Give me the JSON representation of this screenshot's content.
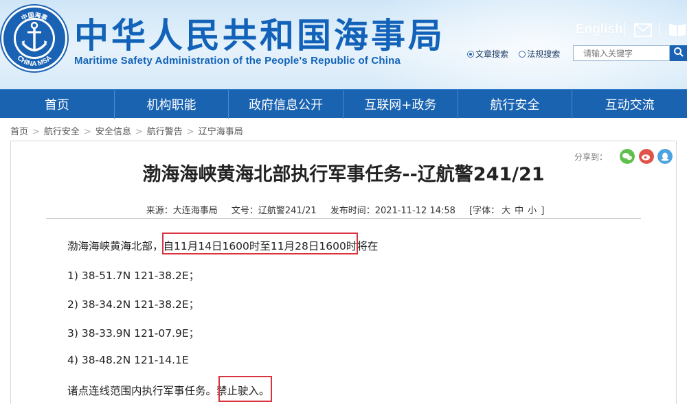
{
  "header": {
    "logo": {
      "top_text": "中国海事",
      "bottom_text": "CHINA MSA",
      "icon": "anchor-icon"
    },
    "site_title_cn": "中华人民共和国海事局",
    "site_title_en": "Maritime Safety Administration of the People's Republic of China",
    "english_link": "English",
    "mail_icon": "mail-icon",
    "book_icon": "book-icon",
    "search": {
      "option_article": "文章搜索",
      "option_regulation": "法规搜索",
      "placeholder": "请输入关键字"
    }
  },
  "nav": {
    "items": [
      "首页",
      "机构职能",
      "政府信息公开",
      "互联网+政务",
      "航行安全",
      "互动交流"
    ]
  },
  "breadcrumb": [
    "首页",
    "航行安全",
    "安全信息",
    "航行警告",
    "辽宁海事局"
  ],
  "share": {
    "label": "分享到："
  },
  "article": {
    "title": "渤海海峡黄海北部执行军事任务--辽航警241/21",
    "meta": {
      "source": "来源：大连海事局",
      "doc_no": "文号：辽航警241/21",
      "publish_time": "发布时间：2021-11-12 14:58",
      "font_label": "[字体：",
      "font_large": "大",
      "font_medium": "中",
      "font_small": "小",
      "font_close": "]"
    },
    "lines": {
      "intro_a": "渤海海峡黄海北部，",
      "intro_b": "自11月14日1600时至11月28日1600时",
      "intro_c": "将在",
      "p1": "1) 38-51.7N    121-38.2E；",
      "p2": "2) 38-34.2N    121-38.2E；",
      "p3": "3) 38-33.9N    121-07.9E；",
      "p4": "4) 38-48.2N    121-14.1E",
      "end_a": "诸点连线范围内执行军事任务。",
      "end_b": "禁止驶入。"
    }
  },
  "colors": {
    "brand_blue": "#1a63b1",
    "highlight_red": "#d9333f"
  }
}
